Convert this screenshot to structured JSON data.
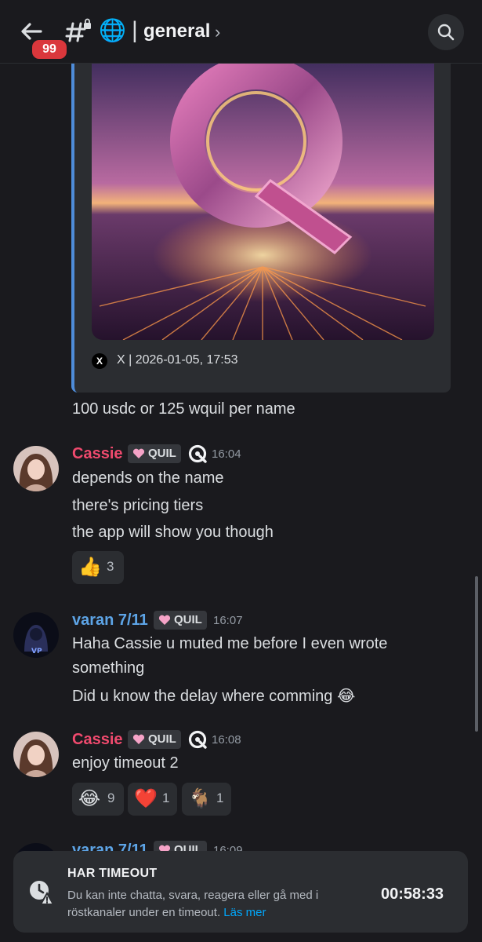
{
  "header": {
    "badge_count": "99",
    "channel_name": "general",
    "globe_emoji": "🌐",
    "separator": "|",
    "chevron": "›"
  },
  "embed": {
    "source_icon": "X",
    "footer": "X | 2026-01-05, 17:53",
    "image_letter": "Q"
  },
  "messages": [
    {
      "text": "100 usdc or 125 wquil per name"
    },
    {
      "author": "Cassie",
      "author_color": "#f04a6e",
      "tag": "QUIL",
      "time": "16:04",
      "lines": [
        "depends on the name",
        "there's pricing tiers",
        "the app will show you though"
      ],
      "reactions": [
        {
          "emoji": "👍",
          "count": "3"
        }
      ]
    },
    {
      "author": "varan 7/11",
      "author_color": "#5da4e6",
      "tag": "QUIL",
      "time": "16:07",
      "lines": [
        "Haha Cassie u muted me before I even wrote",
        "something",
        "Did u know the delay where comming 😂"
      ]
    },
    {
      "author": "Cassie",
      "author_color": "#f04a6e",
      "tag": "QUIL",
      "time": "16:08",
      "lines": [
        "enjoy timeout 2"
      ],
      "reactions": [
        {
          "emoji": "😂",
          "count": "9"
        },
        {
          "emoji": "❤️",
          "count": "1"
        },
        {
          "emoji": "🐐",
          "count": "1"
        }
      ]
    },
    {
      "author": "varan 7/11",
      "tag": "QUIL",
      "time": "16:09"
    }
  ],
  "timeout": {
    "title": "HAR TIMEOUT",
    "description": "Du kan inte chatta, svara, reagera eller gå med i röstkanaler under en timeout.",
    "link": "Läs mer",
    "timer": "00:58:33"
  }
}
